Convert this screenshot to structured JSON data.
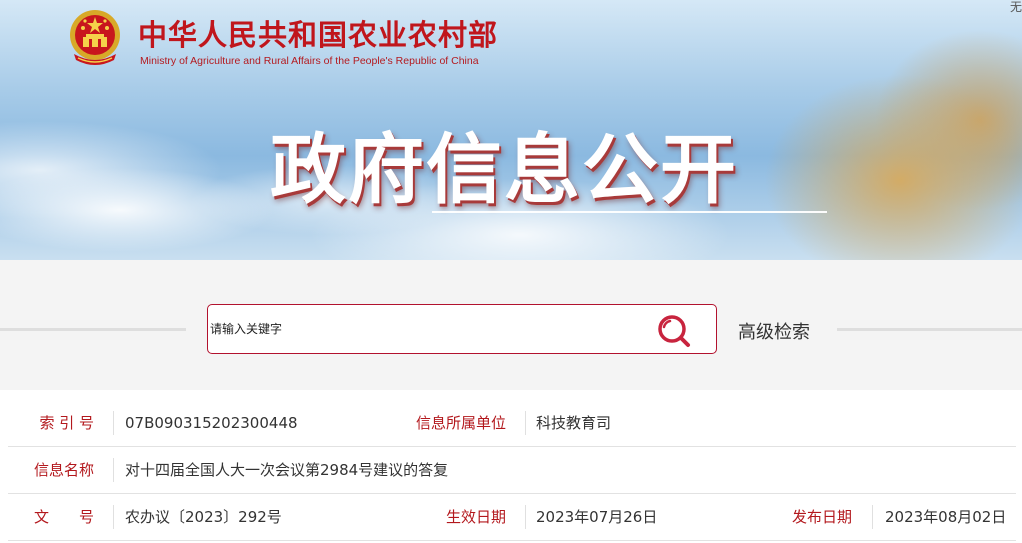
{
  "header": {
    "site_title_cn": "中华人民共和国农业农村部",
    "site_title_en": "Ministry of Agriculture and Rural Affairs of the People's Republic of China",
    "hero_title": "政府信息公开",
    "corner_text": "无",
    "emblem_icon": "national-emblem-icon"
  },
  "search": {
    "placeholder": "请输入关键字",
    "advanced_label": "高级检索",
    "button_icon": "search-icon"
  },
  "info": {
    "index_label": "索 引 号",
    "index_value": "07B090315202300448",
    "unit_label": "信息所属单位",
    "unit_value": "科技教育司",
    "name_label": "信息名称",
    "name_value": "对十四届全国人大一次会议第2984号建议的答复",
    "doc_label": "文　　号",
    "doc_value": "农办议〔2023〕292号",
    "effective_label": "生效日期",
    "effective_value": "2023年07月26日",
    "publish_label": "发布日期",
    "publish_value": "2023年08月02日"
  },
  "colors": {
    "accent": "#b3181d",
    "band_background": "#f4f4f4"
  }
}
